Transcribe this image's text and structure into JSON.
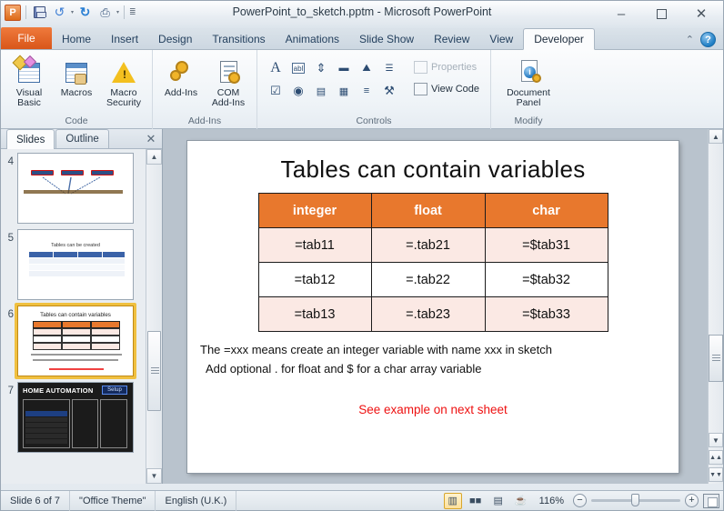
{
  "window": {
    "title": "PowerPoint_to_sketch.pptm  -  Microsoft PowerPoint",
    "app_logo": "P",
    "minimize": "–",
    "maximize": "□",
    "close": "✕"
  },
  "quick_access": [
    {
      "name": "save-icon",
      "glyph": ""
    },
    {
      "name": "undo-icon",
      "glyph": "↶"
    },
    {
      "name": "undo-dropdown-icon",
      "glyph": "▾"
    },
    {
      "name": "redo-icon",
      "glyph": "↻"
    },
    {
      "name": "print-preview-icon",
      "glyph": "⎙"
    },
    {
      "name": "print-dropdown-icon",
      "glyph": "▾"
    },
    {
      "name": "customize-qat-icon",
      "glyph": "☷"
    }
  ],
  "ribbon": {
    "tabs": [
      {
        "label": "File",
        "active": false,
        "file": true
      },
      {
        "label": "Home",
        "active": false
      },
      {
        "label": "Insert",
        "active": false
      },
      {
        "label": "Design",
        "active": false
      },
      {
        "label": "Transitions",
        "active": false
      },
      {
        "label": "Animations",
        "active": false
      },
      {
        "label": "Slide Show",
        "active": false
      },
      {
        "label": "Review",
        "active": false
      },
      {
        "label": "View",
        "active": false
      },
      {
        "label": "Developer",
        "active": true
      }
    ],
    "collapse_icon": "⌃",
    "help_icon": "?",
    "groups": [
      {
        "label": "Code",
        "buttons": [
          {
            "label": "Visual\nBasic",
            "line1": "Visual",
            "line2": "Basic",
            "icon": "visual-basic-icon"
          },
          {
            "label": "Macros",
            "line1": "Macros",
            "line2": "",
            "icon": "macros-icon"
          },
          {
            "label": "Macro Security",
            "line1": "Macro",
            "line2": "Security",
            "icon": "macro-security-icon"
          }
        ]
      },
      {
        "label": "Add-Ins",
        "buttons": [
          {
            "label": "Add-Ins",
            "line1": "Add-Ins",
            "line2": "",
            "icon": "add-ins-icon"
          },
          {
            "label": "COM Add-Ins",
            "line1": "COM",
            "line2": "Add-Ins",
            "icon": "com-add-ins-icon"
          }
        ]
      },
      {
        "label": "Controls",
        "controls": [
          {
            "name": "text-label-control-icon",
            "glyph": "A"
          },
          {
            "name": "text-box-control-icon",
            "glyph": "abl"
          },
          {
            "name": "spin-button-control-icon",
            "glyph": "⇕"
          },
          {
            "name": "command-button-control-icon",
            "glyph": "▬"
          },
          {
            "name": "image-control-icon",
            "glyph": "⛰"
          },
          {
            "name": "scroll-bar-control-icon",
            "glyph": "↕"
          },
          {
            "name": "check-box-control-icon",
            "glyph": "☑"
          },
          {
            "name": "option-button-control-icon",
            "glyph": "◉"
          },
          {
            "name": "list-box-control-icon",
            "glyph": "☰"
          },
          {
            "name": "combo-box-control-icon",
            "glyph": "☷"
          },
          {
            "name": "toggle-button-control-icon",
            "glyph": "≡"
          },
          {
            "name": "more-controls-icon",
            "glyph": "⚒"
          }
        ],
        "side_buttons": [
          {
            "label": "Properties",
            "icon": "properties-icon",
            "disabled": true
          },
          {
            "label": "View Code",
            "icon": "view-code-icon",
            "disabled": false
          }
        ]
      },
      {
        "label": "Modify",
        "buttons": [
          {
            "label": "Document Panel",
            "line1": "Document",
            "line2": "Panel",
            "icon": "document-panel-icon"
          }
        ]
      }
    ]
  },
  "slides_pane": {
    "tabs": [
      {
        "label": "Slides",
        "active": true
      },
      {
        "label": "Outline",
        "active": false
      }
    ],
    "close_icon": "✕",
    "scroll_up_icon": "▲",
    "scroll_down_icon": "▼",
    "thumbnails": [
      {
        "number": "4",
        "title": "",
        "kind": "buttons-slide",
        "selected": false
      },
      {
        "number": "5",
        "title": "Tables can be created",
        "kind": "table-blue",
        "selected": false
      },
      {
        "number": "6",
        "title": "Tables can contain variables",
        "kind": "table-orange",
        "selected": true
      },
      {
        "number": "7",
        "title": "HOME AUTOMATION",
        "kind": "home-automation",
        "selected": false
      }
    ]
  },
  "slide": {
    "title": "Tables can contain variables",
    "table": {
      "headers": [
        "integer",
        "float",
        "char"
      ],
      "rows": [
        [
          "=tab11",
          "=.tab21",
          "=$tab31"
        ],
        [
          "=tab12",
          "=.tab22",
          "=$tab32"
        ],
        [
          "=tab13",
          "=.tab23",
          "=$tab33"
        ]
      ],
      "header_bg": "#e8782d",
      "header_fg": "#ffffff",
      "row_bg_odd": "#fbe9e4",
      "row_bg_even": "#ffffff",
      "border_color": "#1c1c1c"
    },
    "notes": [
      "The =xxx means create an integer  variable  with name xxx in sketch",
      "Add  optional  .  for float  and  $ for  a char array  variable"
    ],
    "footer_note": "See example  on next  sheet",
    "footer_color": "#ee1111"
  },
  "canvas_scroll": {
    "up_icon": "▲",
    "down_icon": "▼",
    "prev_slide_icon": "▲",
    "next_slide_icon": "▼"
  },
  "status_bar": {
    "slide_indicator": "Slide 6 of 7",
    "theme": "\"Office Theme\"",
    "language": "English (U.K.)",
    "view_buttons": [
      {
        "name": "normal-view-button",
        "glyph": "▥",
        "active": true
      },
      {
        "name": "slide-sorter-view-button",
        "glyph": "∷",
        "active": false
      },
      {
        "name": "reading-view-button",
        "glyph": "▤",
        "active": false
      },
      {
        "name": "slide-show-button",
        "glyph": "▷",
        "active": false
      }
    ],
    "zoom_level": "116%",
    "zoom_out_icon": "−",
    "zoom_in_icon": "+",
    "fit_slide_name": "fit-slide-to-window-button"
  }
}
